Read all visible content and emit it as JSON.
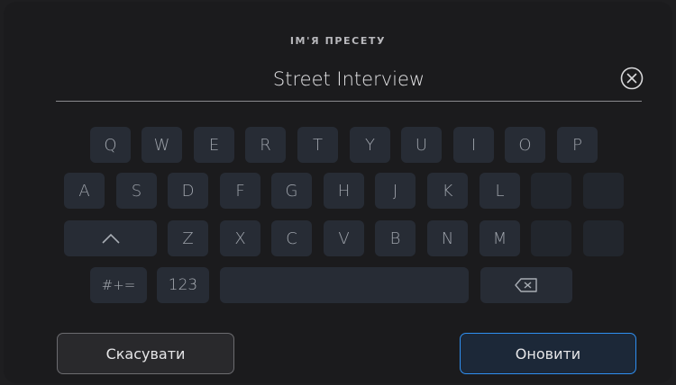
{
  "dialog": {
    "title": "ІМ'Я ПРЕСЕТУ",
    "preset_name": "Street Interview",
    "clear_icon": "circle-x-icon"
  },
  "keyboard": {
    "row1": [
      "Q",
      "W",
      "E",
      "R",
      "T",
      "Y",
      "U",
      "I",
      "O",
      "P"
    ],
    "row2": [
      "A",
      "S",
      "D",
      "F",
      "G",
      "H",
      "J",
      "K",
      "L",
      "",
      ""
    ],
    "row3": [
      "Z",
      "X",
      "C",
      "V",
      "B",
      "N",
      "M",
      "",
      ""
    ],
    "shift_icon": "shift-up-icon",
    "symbols_label": "#+=",
    "numbers_label": "123",
    "backspace_icon": "backspace-icon"
  },
  "actions": {
    "cancel_label": "Скасувати",
    "update_label": "Оновити"
  },
  "colors": {
    "background": "#1b1b1d",
    "key": "#272c35",
    "accent": "#2f8ff0"
  }
}
